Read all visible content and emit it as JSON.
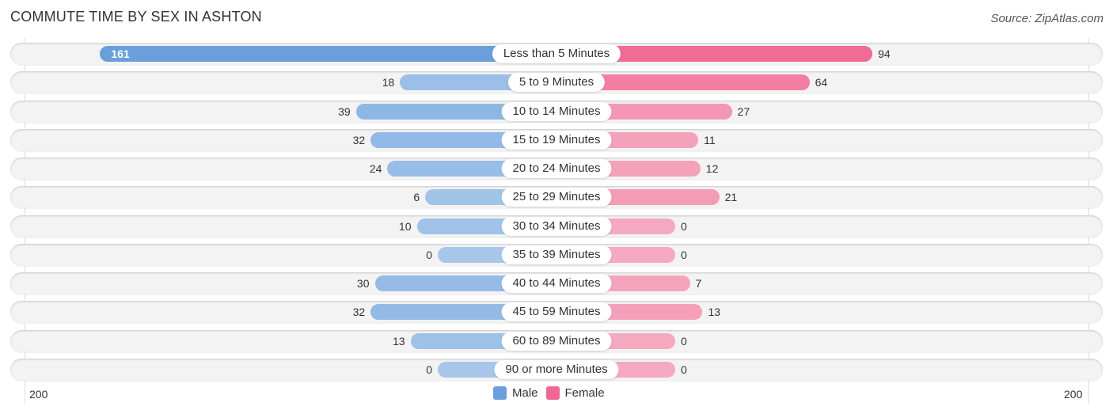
{
  "title": "COMMUTE TIME BY SEX IN ASHTON",
  "source": "Source: ZipAtlas.com",
  "colors": {
    "male": "#6a9fdc",
    "male_light": "#a7c6ea",
    "female": "#f06792",
    "female_light": "#f5a9c0"
  },
  "chart_data": {
    "type": "bar",
    "orientation": "horizontal-diverging",
    "title": "COMMUTE TIME BY SEX IN ASHTON",
    "categories": [
      "Less than 5 Minutes",
      "5 to 9 Minutes",
      "10 to 14 Minutes",
      "15 to 19 Minutes",
      "20 to 24 Minutes",
      "25 to 29 Minutes",
      "30 to 34 Minutes",
      "35 to 39 Minutes",
      "40 to 44 Minutes",
      "45 to 59 Minutes",
      "60 to 89 Minutes",
      "90 or more Minutes"
    ],
    "series": [
      {
        "name": "Male",
        "values": [
          161,
          18,
          39,
          32,
          24,
          6,
          10,
          0,
          30,
          32,
          13,
          0
        ]
      },
      {
        "name": "Female",
        "values": [
          94,
          64,
          27,
          11,
          12,
          21,
          0,
          0,
          7,
          13,
          0,
          0
        ]
      }
    ],
    "xlim": [
      -200,
      200
    ],
    "tick_labels": {
      "left": "200",
      "right": "200"
    },
    "legend": [
      "Male",
      "Female"
    ],
    "legend_position": "bottom-center"
  }
}
